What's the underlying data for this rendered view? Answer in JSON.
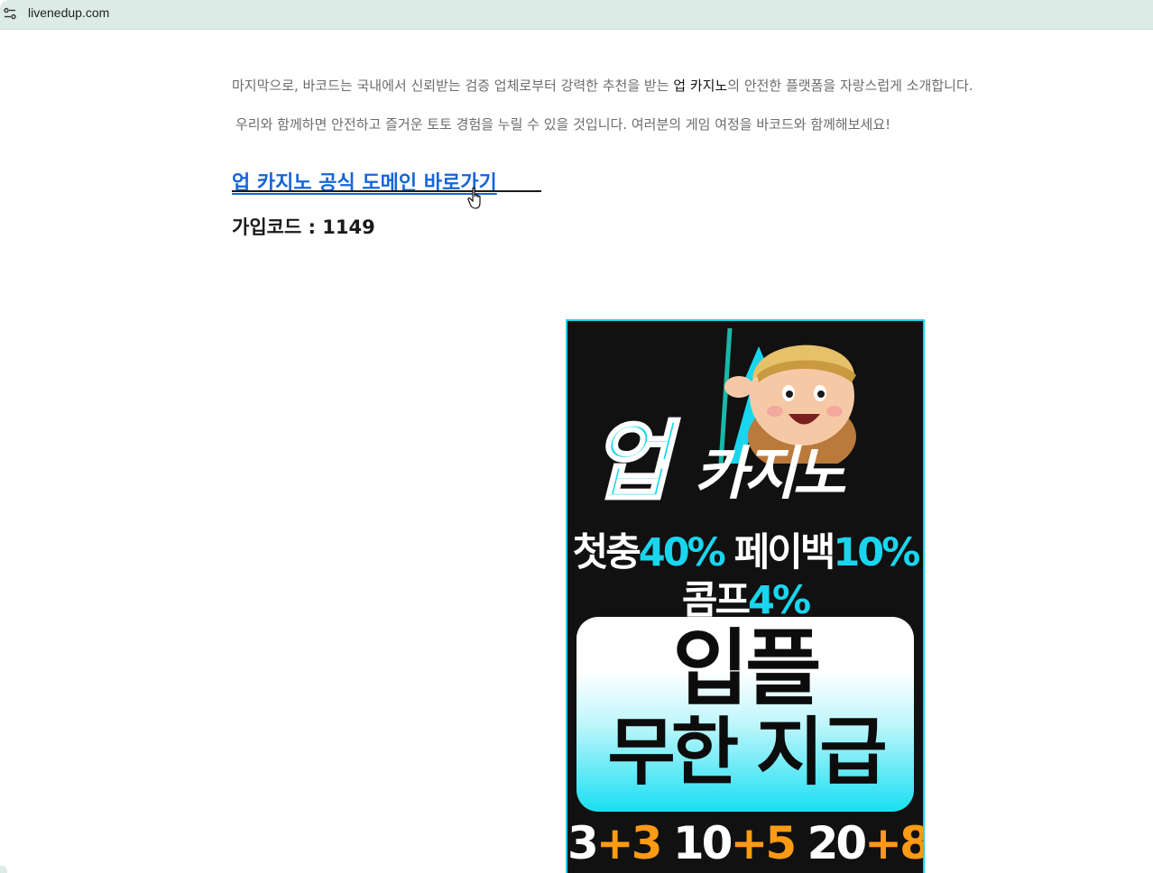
{
  "browser": {
    "url": "livenedup.com",
    "icon": "site-info-icon"
  },
  "article": {
    "para1_before": "마지막으로, 바코드는 국내에서 신뢰받는 검증 업체로부터 강력한 추천을 받는 ",
    "para1_brand": "업 카지노",
    "para1_after": "의 안전한 플랫폼을 자랑스럽게 소개합니다.",
    "para2": "우리와 함께하면 안전하고 즐거운 토토 경험을 누릴 수 있을 것입니다. 여러분의 게임 여정을 바코드와 함께해보세요!",
    "link_text": "업 카지노 공식 도메인 바로가기",
    "signup_code": "가입코드 : 1149"
  },
  "banner": {
    "logo_big": "업",
    "logo_rest": "카지노",
    "line1_a": "첫충",
    "line1_b": "40%",
    "line1_c": " 페이백",
    "line1_d": "10%",
    "line2_a": "콤프",
    "line2_b": "4%",
    "box_line1": "입플",
    "box_line2": "무한 지급",
    "bonus_1a": "3",
    "bonus_1b": "+3",
    "bonus_2a": " 10",
    "bonus_2b": "+5",
    "bonus_3a": " 20",
    "bonus_3b": "+8",
    "colors": {
      "accent": "#19d6ee",
      "orange": "#ff9a14",
      "bg": "#111111"
    }
  }
}
